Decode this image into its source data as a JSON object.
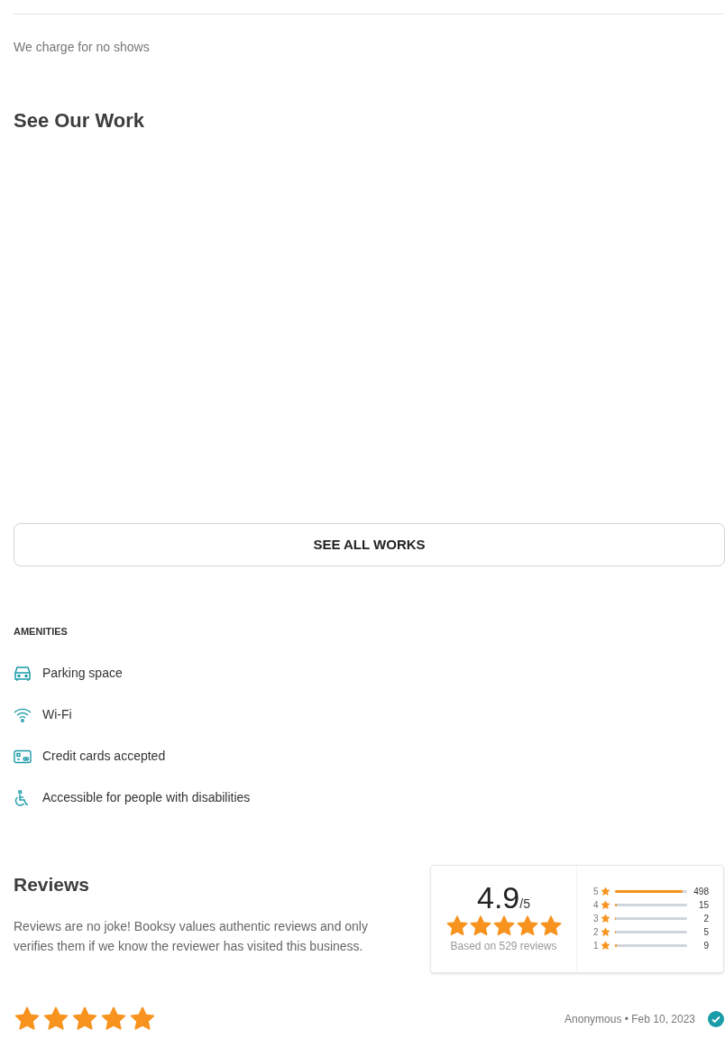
{
  "policy_note": "We charge for no shows",
  "work": {
    "title": "See Our Work",
    "button": "SEE ALL WORKS"
  },
  "amenities": {
    "title": "AMENITIES",
    "items": [
      {
        "kind": "car",
        "label": "Parking space"
      },
      {
        "kind": "wifi",
        "label": "Wi-Fi"
      },
      {
        "kind": "card",
        "label": "Credit cards accepted"
      },
      {
        "kind": "wheelchair",
        "label": "Accessible for people with disabilities"
      }
    ]
  },
  "reviews": {
    "title": "Reviews",
    "description": "Reviews are no joke! Booksy values authentic reviews and only verifies them if we know the reviewer has visited this business.",
    "summary": {
      "score": "4.9",
      "out_of": "/5",
      "stars": 5,
      "based_on": "Based on 529 reviews"
    },
    "breakdown": [
      {
        "rating": "5",
        "count": "498",
        "level": 0.94
      },
      {
        "rating": "4",
        "count": "15",
        "level": 0.03
      },
      {
        "rating": "3",
        "count": "2",
        "level": 0.01
      },
      {
        "rating": "2",
        "count": "5",
        "level": 0.01
      },
      {
        "rating": "1",
        "count": "9",
        "level": 0.02
      }
    ],
    "items": [
      {
        "stars": 5,
        "author": "Anonymous • Feb 10, 2023",
        "verified": true
      }
    ]
  }
}
